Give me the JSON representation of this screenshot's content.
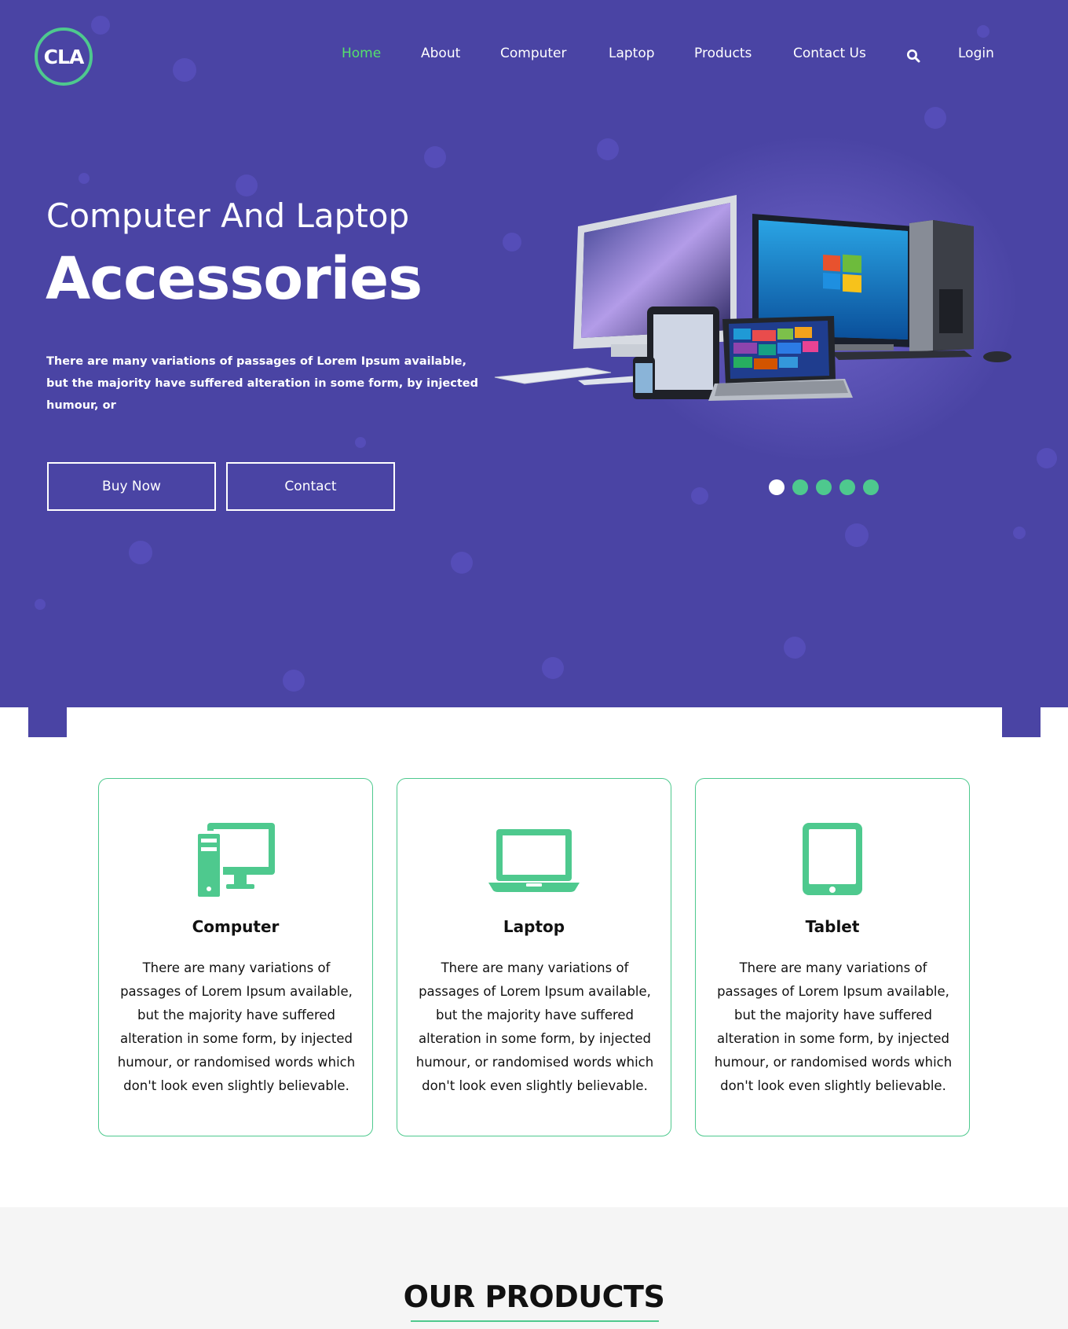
{
  "header": {
    "logo_text": "CLA",
    "nav": [
      {
        "label": "Home",
        "active": true
      },
      {
        "label": "About",
        "active": false
      },
      {
        "label": "Computer",
        "active": false
      },
      {
        "label": "Laptop",
        "active": false
      },
      {
        "label": "Products",
        "active": false
      },
      {
        "label": "Contact Us",
        "active": false
      },
      {
        "label": "Login",
        "active": false
      }
    ],
    "search_icon": "search-icon"
  },
  "hero": {
    "subtitle": "Computer And Laptop",
    "title": "Accessories",
    "description": "There are many variations of passages of Lorem Ipsum available, but the majority have suffered alteration in some form, by injected humour, or",
    "buy_label": "Buy Now",
    "contact_label": "Contact",
    "slides_count": 5,
    "active_slide": 1
  },
  "features": [
    {
      "icon": "desktop-computer-icon",
      "title": "Computer",
      "text": "There are many variations of passages of Lorem Ipsum available, but the majority have suffered alteration in some form, by injected humour, or randomised words which don't look even slightly believable."
    },
    {
      "icon": "laptop-icon",
      "title": "Laptop",
      "text": "There are many variations of passages of Lorem Ipsum available, but the majority have suffered alteration in some form, by injected humour, or randomised words which don't look even slightly believable."
    },
    {
      "icon": "tablet-icon",
      "title": "Tablet",
      "text": "There are many variations of passages of Lorem Ipsum available, but the majority have suffered alteration in some form, by injected humour, or randomised words which don't look even slightly believable."
    }
  ],
  "products_section": {
    "title": "OUR PRODUCTS"
  },
  "colors": {
    "hero_bg": "#4a44a4",
    "accent": "#4ec98e",
    "active_nav": "#55e06c",
    "section_bg": "#f5f5f5"
  }
}
